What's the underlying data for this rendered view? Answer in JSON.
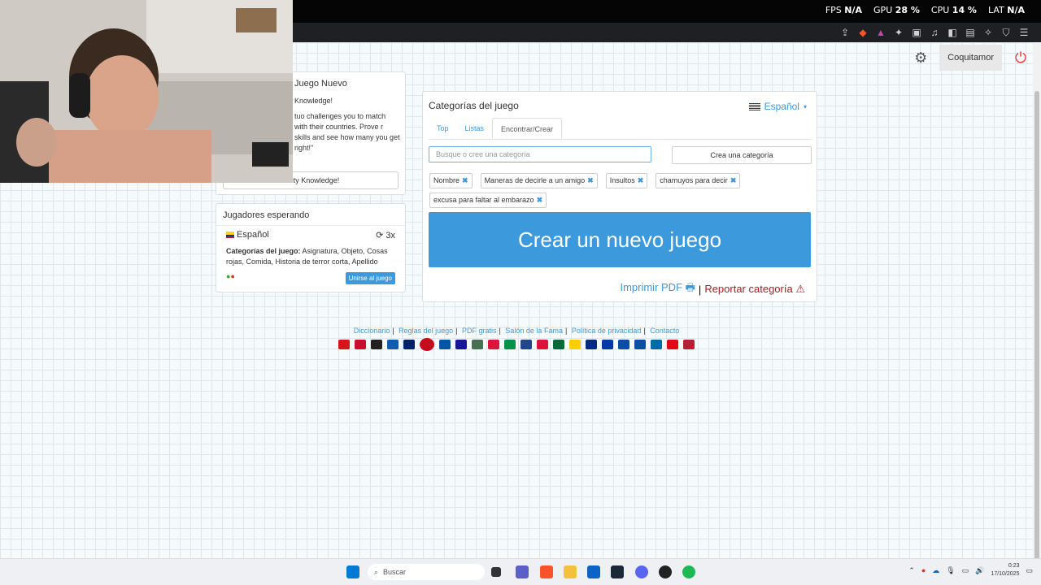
{
  "overlay": {
    "fps_label": "FPS",
    "fps_value": "N/A",
    "gpu_label": "GPU",
    "gpu_value": "28 %",
    "cpu_label": "CPU",
    "cpu_value": "14 %",
    "lat_label": "LAT",
    "lat_value": "N/A"
  },
  "nav": {
    "user": "Coquitamor"
  },
  "new_game_panel": {
    "title": "Juego Nuevo",
    "subtitle": "Knowledge!",
    "description": "tuo challenges you to match with their countries. Prove r skills and see how many you get right!\"",
    "button": "r City Knowledge!"
  },
  "waiting_panel": {
    "title": "Jugadores esperando",
    "language": "Español",
    "rounds": "3x",
    "cats_label": "Categorías del juego:",
    "cats_value": "Asignatura, Objeto, Cosas rojas, Comida, Historia de terror corta, Apellido",
    "join": "Unirse al juego"
  },
  "main": {
    "title": "Categorías del juego",
    "language": "Español",
    "tabs": [
      "Top",
      "Listas",
      "Encontrar/Crear"
    ],
    "search_placeholder": "Busque o cree una categoría",
    "create_category": "Crea una categoría",
    "tags": [
      "Nombre",
      "Maneras de decirle a un amigo",
      "Insultos",
      "chamuyos para decir",
      "excusa para faltar al embarazo"
    ],
    "create_game": "Crear un nuevo juego",
    "print_pdf": "Imprimir PDF",
    "separator": "|",
    "report": "Reportar categoría"
  },
  "footer": {
    "links": [
      "Diccionario",
      "Reglas del juego",
      "PDF gratis",
      "Salón de la Fama",
      "Política de privacidad",
      "Contacto"
    ]
  },
  "flag_colors": [
    "#d7141a",
    "#c8102e",
    "#222222",
    "#0d5eaf",
    "#012169",
    "#c60b1e",
    "#0055a4",
    "#171796",
    "#477050",
    "#dc143c",
    "#009246",
    "#21468b",
    "#dc143c",
    "#046a38",
    "#ffcd00",
    "#002b7f",
    "#0039a6",
    "#0b4ea2",
    "#0b4ea2",
    "#006aa7",
    "#e30a17",
    "#b22234"
  ],
  "taskbar": {
    "search": "Buscar",
    "time": "0:23",
    "date": "17/10/2025"
  }
}
